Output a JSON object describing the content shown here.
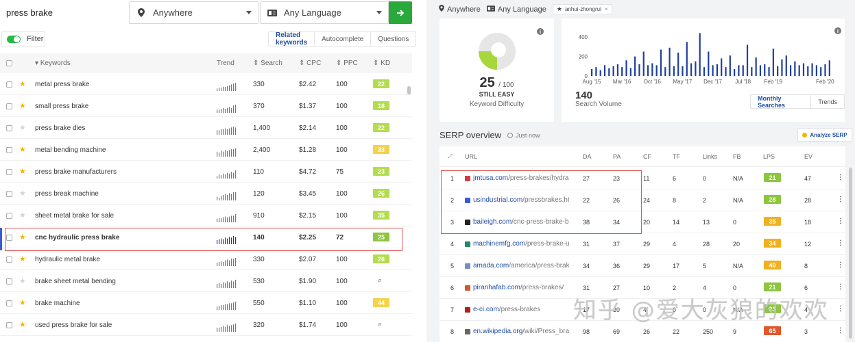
{
  "search": {
    "query": "press brake",
    "location": "Anywhere",
    "language": "Any Language"
  },
  "filter": {
    "label": "Filter"
  },
  "tabs": [
    "Related keywords",
    "Autocomplete",
    "Questions"
  ],
  "kw_headers": {
    "keywords": "Keywords",
    "trend": "Trend",
    "search": "Search",
    "cpc": "CPC",
    "ppc": "PPC",
    "kd": "KD"
  },
  "keywords": [
    {
      "kw": "metal press brake",
      "star": true,
      "search": "330",
      "cpc": "$2.42",
      "ppc": "100",
      "kd": "22",
      "kd_color": "#b3dd4e",
      "trend": [
        3,
        4,
        4,
        5,
        5,
        6,
        7,
        8,
        9,
        10
      ]
    },
    {
      "kw": "small press brake",
      "star": true,
      "search": "370",
      "cpc": "$1.37",
      "ppc": "100",
      "kd": "18",
      "kd_color": "#b3dd4e",
      "trend": [
        4,
        4,
        5,
        6,
        5,
        6,
        7,
        6,
        9,
        10
      ]
    },
    {
      "kw": "press brake dies",
      "star": false,
      "search": "1,400",
      "cpc": "$2.14",
      "ppc": "100",
      "kd": "22",
      "kd_color": "#b3dd4e",
      "trend": [
        5,
        5,
        6,
        6,
        7,
        6,
        7,
        8,
        9,
        8
      ]
    },
    {
      "kw": "metal bending machine",
      "star": true,
      "search": "2,400",
      "cpc": "$1.28",
      "ppc": "100",
      "kd": "33",
      "kd_color": "#f3d34a",
      "trend": [
        6,
        5,
        7,
        6,
        8,
        7,
        8,
        9,
        9,
        10
      ]
    },
    {
      "kw": "press brake manufacturers",
      "star": true,
      "search": "110",
      "cpc": "$4.72",
      "ppc": "75",
      "kd": "23",
      "kd_color": "#b3dd4e",
      "trend": [
        3,
        5,
        4,
        6,
        5,
        7,
        6,
        8,
        7,
        10
      ]
    },
    {
      "kw": "press break machine",
      "star": false,
      "search": "120",
      "cpc": "$3.45",
      "ppc": "100",
      "kd": "26",
      "kd_color": "#b3dd4e",
      "trend": [
        4,
        3,
        5,
        6,
        7,
        6,
        8,
        7,
        9,
        9
      ]
    },
    {
      "kw": "sheet metal brake for sale",
      "star": false,
      "search": "910",
      "cpc": "$2.15",
      "ppc": "100",
      "kd": "35",
      "kd_color": "#b3dd4e",
      "trend": [
        4,
        5,
        5,
        6,
        7,
        6,
        7,
        8,
        8,
        10
      ]
    },
    {
      "kw": "cnc hydraulic press brake",
      "star": true,
      "search": "140",
      "cpc": "$2.25",
      "ppc": "72",
      "kd": "25",
      "kd_color": "#8cc63f",
      "trend": [
        5,
        6,
        7,
        6,
        8,
        7,
        9,
        8,
        10,
        9
      ],
      "highlight": true
    },
    {
      "kw": "hydraulic metal brake",
      "star": true,
      "search": "330",
      "cpc": "$2.07",
      "ppc": "100",
      "kd": "28",
      "kd_color": "#b3dd4e",
      "trend": [
        4,
        5,
        6,
        5,
        7,
        8,
        7,
        9,
        9,
        10
      ]
    },
    {
      "kw": "brake sheet metal bending",
      "star": false,
      "search": "530",
      "cpc": "$1.90",
      "ppc": "100",
      "kd": "",
      "kd_color": "",
      "trend": [
        5,
        6,
        5,
        7,
        6,
        8,
        7,
        9,
        8,
        10
      ]
    },
    {
      "kw": "brake machine",
      "star": true,
      "search": "550",
      "cpc": "$1.10",
      "ppc": "100",
      "kd": "44",
      "kd_color": "#f3d34a",
      "trend": [
        4,
        5,
        6,
        6,
        7,
        7,
        8,
        8,
        9,
        10
      ]
    },
    {
      "kw": "used press brake for sale",
      "star": true,
      "search": "320",
      "cpc": "$1.74",
      "ppc": "100",
      "kd": "",
      "kd_color": "",
      "trend": [
        5,
        5,
        6,
        7,
        6,
        8,
        7,
        8,
        9,
        10
      ]
    }
  ],
  "right_filters": {
    "location": "Anywhere",
    "language": "Any Language",
    "chip": "anhui-zhongrui",
    "chip_close": "×"
  },
  "kd_card": {
    "value": "25",
    "max": "/ 100",
    "label": "STILL EASY",
    "sub": "Keyword Difficulty",
    "fraction": 0.25,
    "color": "#a6d73d",
    "info": "i"
  },
  "sv_card": {
    "value": "140",
    "sub": "Search Volume",
    "tabs": [
      "Monthly Searches",
      "Trends"
    ],
    "info": "i"
  },
  "chart_data": {
    "type": "bar",
    "categories": [
      "Aug '15",
      "Sep '15",
      "Oct '15",
      "Nov '15",
      "Dec '15",
      "Jan '16",
      "Feb '16",
      "Mar '16",
      "Apr '16",
      "May '16",
      "Jun '16",
      "Jul '16",
      "Aug '16",
      "Sep '16",
      "Oct '16",
      "Nov '16",
      "Dec '16",
      "Jan '17",
      "Feb '17",
      "Mar '17",
      "Apr '17",
      "May '17",
      "Jun '17",
      "Jul '17",
      "Aug '17",
      "Sep '17",
      "Oct '17",
      "Nov '17",
      "Dec '17",
      "Jan '18",
      "Feb '18",
      "Mar '18",
      "Apr '18",
      "May '18",
      "Jun '18",
      "Jul '18",
      "Aug '18",
      "Sep '18",
      "Oct '18",
      "Nov '18",
      "Dec '18",
      "Jan '19",
      "Feb '19",
      "Mar '19",
      "Apr '19",
      "May '19",
      "Jun '19",
      "Jul '19",
      "Aug '19",
      "Sep '19",
      "Oct '19",
      "Nov '19",
      "Dec '19",
      "Jan '20",
      "Feb '20",
      "Mar '20"
    ],
    "values": [
      70,
      90,
      60,
      110,
      80,
      100,
      120,
      90,
      160,
      80,
      200,
      120,
      250,
      110,
      130,
      110,
      270,
      90,
      290,
      100,
      240,
      100,
      350,
      130,
      150,
      440,
      90,
      250,
      110,
      120,
      180,
      90,
      210,
      70,
      110,
      110,
      320,
      90,
      190,
      110,
      120,
      90,
      280,
      100,
      170,
      210,
      110,
      150,
      110,
      130,
      100,
      130,
      110,
      90,
      120,
      160
    ],
    "x_ticks": [
      "Aug '15",
      "Mar '16",
      "Oct '16",
      "May '17",
      "Dec '17",
      "Jul '18",
      "Feb '19",
      "Feb '20"
    ],
    "y_ticks": [
      "0",
      "200",
      "400"
    ],
    "ylim": [
      0,
      450
    ],
    "color": "#1f3f9e"
  },
  "serp": {
    "title": "SERP overview",
    "time": "Just now",
    "analyze": "Analyze SERP",
    "headers": {
      "url": "URL",
      "da": "DA",
      "pa": "PA",
      "cf": "CF",
      "tf": "TF",
      "links": "Links",
      "fb": "FB",
      "lps": "LPS",
      "ev": "EV"
    },
    "rows": [
      {
        "n": "1",
        "domain": "jmtusa.com",
        "path": "/press-brakes/hydra...",
        "da": "27",
        "pa": "23",
        "cf": "11",
        "tf": "6",
        "links": "0",
        "fb": "N/A",
        "lps": "21",
        "lps_color": "#8cc63f",
        "ev": "47",
        "fav": "#d23c3c"
      },
      {
        "n": "2",
        "domain": "usindustrial.com",
        "path": "/pressbrakes.ht...",
        "da": "22",
        "pa": "26",
        "cf": "24",
        "tf": "8",
        "links": "2",
        "fb": "N/A",
        "lps": "28",
        "lps_color": "#8cc63f",
        "ev": "28",
        "fav": "#3b5bd6"
      },
      {
        "n": "3",
        "domain": "baileigh.com",
        "path": "/cnc-press-brake-bp...",
        "da": "38",
        "pa": "34",
        "cf": "20",
        "tf": "14",
        "links": "13",
        "fb": "0",
        "lps": "35",
        "lps_color": "#f0b022",
        "ev": "18",
        "fav": "#222222"
      },
      {
        "n": "4",
        "domain": "machinemfg.com",
        "path": "/press-brake-ul...",
        "da": "31",
        "pa": "37",
        "cf": "29",
        "tf": "4",
        "links": "28",
        "fb": "20",
        "lps": "34",
        "lps_color": "#f0b022",
        "ev": "12",
        "fav": "#1f8a6f"
      },
      {
        "n": "5",
        "domain": "amada.com",
        "path": "/america/press-brak...",
        "da": "34",
        "pa": "36",
        "cf": "29",
        "tf": "17",
        "links": "5",
        "fb": "N/A",
        "lps": "40",
        "lps_color": "#f0b022",
        "ev": "8",
        "fav": "#7a8cc4"
      },
      {
        "n": "6",
        "domain": "piranhafab.com",
        "path": "/press-brakes/",
        "da": "31",
        "pa": "27",
        "cf": "10",
        "tf": "2",
        "links": "4",
        "fb": "0",
        "lps": "21",
        "lps_color": "#8cc63f",
        "ev": "6",
        "fav": "#d05a2a"
      },
      {
        "n": "7",
        "domain": "e-ci.com",
        "path": "/press-brakes",
        "da": "17",
        "pa": "30",
        "cf": "4",
        "tf": "0",
        "links": "0",
        "fb": "N/A",
        "lps": "23",
        "lps_color": "#8cc63f",
        "ev": "4",
        "fav": "#b32020"
      },
      {
        "n": "8",
        "domain": "en.wikipedia.org",
        "path": "/wiki/Press_bra...",
        "da": "98",
        "pa": "69",
        "cf": "26",
        "tf": "22",
        "links": "250",
        "fb": "9",
        "lps": "65",
        "lps_color": "#e2572b",
        "ev": "3",
        "fav": "#666666"
      }
    ]
  },
  "watermark": "知乎 @爱大灰狼的欢欢"
}
